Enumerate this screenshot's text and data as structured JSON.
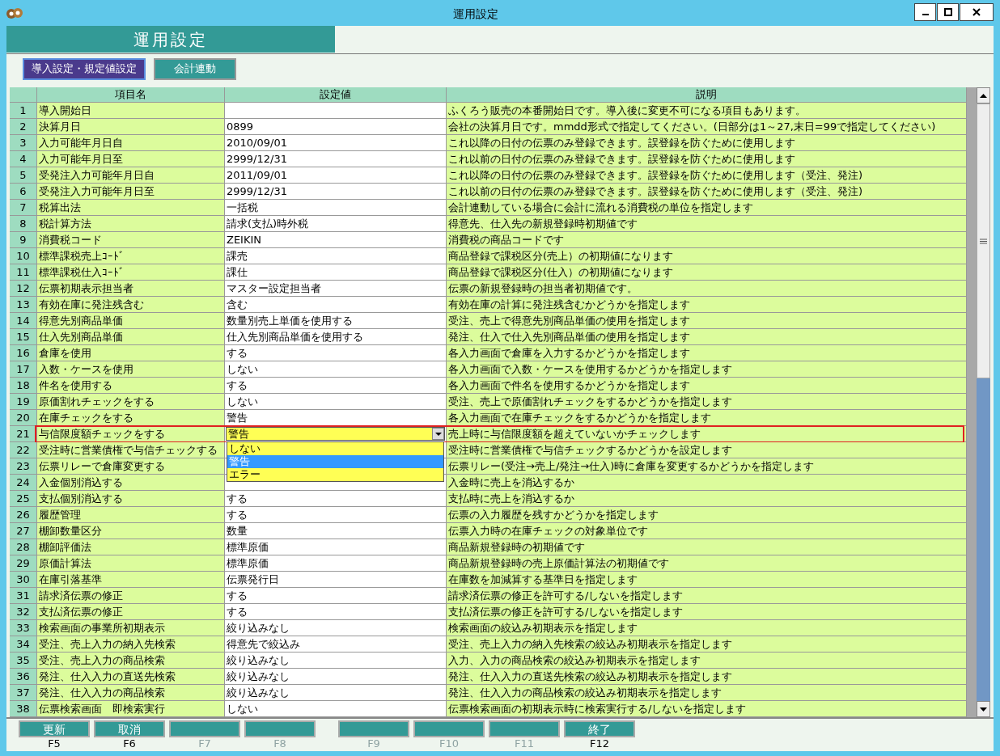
{
  "window": {
    "title": "運用設定"
  },
  "header": {
    "title": "運用設定"
  },
  "tabs": [
    {
      "label": "導入設定・規定値設定",
      "selected": true
    },
    {
      "label": "会計連動",
      "selected": false
    }
  ],
  "table": {
    "columns": [
      "項目名",
      "設定値",
      "説明"
    ],
    "rows": [
      {
        "no": "1",
        "name": "導入開始日",
        "description": "ふくろう販売の本番開始日です。導入後に変更不可になる項目もあります。",
        "highlighted": false
      },
      {
        "no": "2",
        "name": "決算月日",
        "value": "0899",
        "description": "会社の決算月日です。mmdd形式で指定してください。(日部分は1～27,末日=99で指定してください)",
        "highlighted": false
      },
      {
        "no": "3",
        "name": "入力可能年月日自",
        "value": "2010/09/01",
        "description": "これ以降の日付の伝票のみ登録できます。誤登録を防ぐために使用します",
        "highlighted": false
      },
      {
        "no": "4",
        "name": "入力可能年月日至",
        "value": "2999/12/31",
        "description": "これ以前の日付の伝票のみ登録できます。誤登録を防ぐために使用します",
        "highlighted": false
      },
      {
        "no": "5",
        "name": "受発注入力可能年月日自",
        "value": "2011/09/01",
        "description": "これ以降の日付の伝票のみ登録できます。誤登録を防ぐために使用します（受注、発注)",
        "highlighted": false
      },
      {
        "no": "6",
        "name": "受発注入力可能年月日至",
        "value": "2999/12/31",
        "description": "これ以前の日付の伝票のみ登録できます。誤登録を防ぐために使用します（受注、発注)",
        "highlighted": false
      },
      {
        "no": "7",
        "name": "税算出法",
        "value": "一括税",
        "description": "会計連動している場合に会計に流れる消費税の単位を指定します",
        "highlighted": false
      },
      {
        "no": "8",
        "name": "税計算方法",
        "value": "請求(支払)時外税",
        "description": "得意先、仕入先の新規登録時初期値です",
        "highlighted": false
      },
      {
        "no": "9",
        "name": "消費税コード",
        "value": "ZEIKIN",
        "description": "消費税の商品コードです",
        "highlighted": false
      },
      {
        "no": "10",
        "name": "標準課税売上ｺｰﾄﾞ",
        "value": "課売",
        "description": "商品登録で課税区分(売上）の初期値になります",
        "highlighted": false
      },
      {
        "no": "11",
        "name": "標準課税仕入ｺｰﾄﾞ",
        "value": "課仕",
        "description": "商品登録で課税区分(仕入）の初期値になります",
        "highlighted": false
      },
      {
        "no": "12",
        "name": "伝票初期表示担当者",
        "value": "マスター設定担当者",
        "description": "伝票の新規登録時の担当者初期値です。",
        "highlighted": false
      },
      {
        "no": "13",
        "name": "有効在庫に発注残含む",
        "value": "含む",
        "description": "有効在庫の計算に発注残含むかどうかを指定します",
        "highlighted": false
      },
      {
        "no": "14",
        "name": "得意先別商品単価",
        "value": "数量別売上単価を使用する",
        "description": "受注、売上で得意先別商品単価の使用を指定します",
        "highlighted": false
      },
      {
        "no": "15",
        "name": "仕入先別商品単価",
        "value": "仕入先別商品単価を使用する",
        "description": "発注、仕入で仕入先別商品単価の使用を指定します",
        "highlighted": false
      },
      {
        "no": "16",
        "name": "倉庫を使用",
        "value": "する",
        "description": "各入力画面で倉庫を入力するかどうかを指定します",
        "highlighted": false
      },
      {
        "no": "17",
        "name": "入数・ケースを使用",
        "value": "しない",
        "description": "各入力画面で入数・ケースを使用するかどうかを指定します",
        "highlighted": false
      },
      {
        "no": "18",
        "name": "件名を使用する",
        "value": "する",
        "description": "各入力画面で件名を使用するかどうかを指定します",
        "highlighted": false
      },
      {
        "no": "19",
        "name": "原価割れチェックをする",
        "value": "しない",
        "description": "受注、売上で原価割れチェックをするかどうかを指定します",
        "highlighted": false
      },
      {
        "no": "20",
        "name": "在庫チェックをする",
        "value": "警告",
        "description": "各入力画面で在庫チェックをするかどうかを指定します",
        "highlighted": false
      },
      {
        "no": "21",
        "name": "与信限度額チェックをする",
        "value": "警告",
        "description": "売上時に与信限度額を超えていないかチェックします",
        "highlighted": true,
        "kind": "dropdown",
        "options": [
          {
            "label": "しない",
            "selected": false
          },
          {
            "label": "警告",
            "selected": true
          },
          {
            "label": "エラー",
            "selected": false
          }
        ]
      },
      {
        "no": "22",
        "name": "受注時に営業債権で与信チェックする",
        "description": "受注時に営業債権で与信チェックするかどうかを設定します",
        "highlighted": false
      },
      {
        "no": "23",
        "name": "伝票リレーで倉庫変更する",
        "description": "伝票リレー(受注→売上/発注→仕入)時に倉庫を変更するかどうかを指定します",
        "highlighted": false
      },
      {
        "no": "24",
        "name": "入金個別消込する",
        "description": "入金時に売上を消込するか",
        "highlighted": false
      },
      {
        "no": "25",
        "name": "支払個別消込する",
        "value": "する",
        "description": "支払時に売上を消込するか",
        "highlighted": false
      },
      {
        "no": "26",
        "name": "履歴管理",
        "value": "する",
        "description": "伝票の入力履歴を残すかどうかを指定します",
        "highlighted": false
      },
      {
        "no": "27",
        "name": "棚卸数量区分",
        "value": "数量",
        "description": "伝票入力時の在庫チェックの対象単位です",
        "highlighted": false
      },
      {
        "no": "28",
        "name": "棚卸評価法",
        "value": "標準原価",
        "description": "商品新規登録時の初期値です",
        "highlighted": false
      },
      {
        "no": "29",
        "name": "原価計算法",
        "value": "標準原価",
        "description": "商品新規登録時の売上原価計算法の初期値です",
        "highlighted": false
      },
      {
        "no": "30",
        "name": "在庫引落基準",
        "value": "伝票発行日",
        "description": "在庫数を加減算する基準日を指定します",
        "highlighted": false
      },
      {
        "no": "31",
        "name": "請求済伝票の修正",
        "value": "する",
        "description": "請求済伝票の修正を許可する/しないを指定します",
        "highlighted": false
      },
      {
        "no": "32",
        "name": "支払済伝票の修正",
        "value": "する",
        "description": "支払済伝票の修正を許可する/しないを指定します",
        "highlighted": false
      },
      {
        "no": "33",
        "name": "検索画面の事業所初期表示",
        "value": "絞り込みなし",
        "description": "検索画面の絞込み初期表示を指定します",
        "highlighted": false
      },
      {
        "no": "34",
        "name": "受注、売上入力の納入先検索",
        "value": "得意先で絞込み",
        "description": "受注、売上入力の納入先検索の絞込み初期表示を指定します",
        "highlighted": false
      },
      {
        "no": "35",
        "name": "受注、売上入力の商品検索",
        "value": "絞り込みなし",
        "description": "入力、入力の商品検索の絞込み初期表示を指定します",
        "highlighted": false
      },
      {
        "no": "36",
        "name": "発注、仕入入力の直送先検索",
        "value": "絞り込みなし",
        "description": "発注、仕入入力の直送先検索の絞込み初期表示を指定します",
        "highlighted": false
      },
      {
        "no": "37",
        "name": "発注、仕入入力の商品検索",
        "value": "絞り込みなし",
        "description": "発注、仕入入力の商品検索の絞込み初期表示を指定します",
        "highlighted": false
      },
      {
        "no": "38",
        "name": "伝票検索画面　即検索実行",
        "value": "しない",
        "description": "伝票検索画面の初期表示時に検索実行する/しないを指定します",
        "highlighted": false
      }
    ]
  },
  "function_keys": [
    {
      "label": "更新",
      "key": "F5",
      "disabled": false
    },
    {
      "label": "取消",
      "key": "F6",
      "disabled": false
    },
    {
      "key": "F7",
      "disabled": true
    },
    {
      "key": "F8",
      "disabled": true
    },
    {
      "key": "F9",
      "disabled": true
    },
    {
      "key": "F10",
      "disabled": true
    },
    {
      "key": "F11",
      "disabled": true
    },
    {
      "label": "終了",
      "key": "F12",
      "disabled": false
    }
  ]
}
